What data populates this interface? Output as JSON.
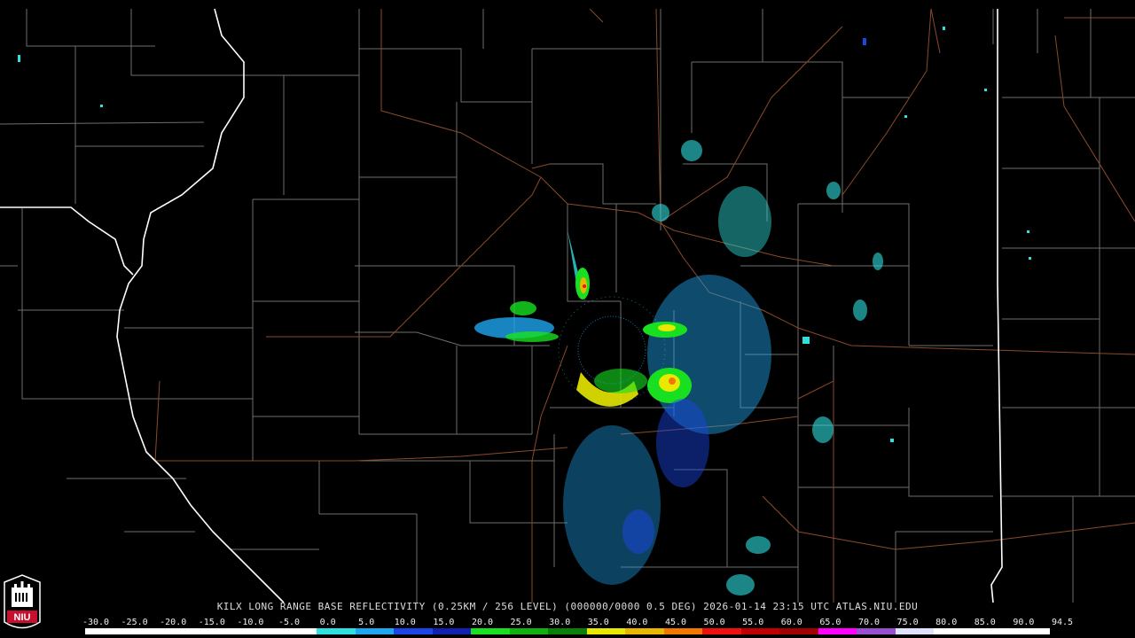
{
  "caption": "KILX LONG RANGE BASE REFLECTIVITY (0.25KM / 256 LEVEL) (000000/0000 0.5 DEG) 2026-01-14 23:15 UTC  ATLAS.NIU.EDU",
  "logo_text": "NIU",
  "colors": {
    "background": "#000000",
    "county_lines": "#8a8a8a",
    "state_lines": "#ffffff",
    "highways": "#8b4a2b"
  },
  "scale": {
    "labels": [
      "-30.0",
      "-25.0",
      "-20.0",
      "-15.0",
      "-10.0",
      "-5.0",
      "0.0",
      "5.0",
      "10.0",
      "15.0",
      "20.0",
      "25.0",
      "30.0",
      "35.0",
      "40.0",
      "45.0",
      "50.0",
      "55.0",
      "60.0",
      "65.0",
      "70.0",
      "75.0",
      "80.0",
      "85.0",
      "90.0",
      "94.5"
    ],
    "colors": [
      "#ffffff",
      "#ffffff",
      "#ffffff",
      "#ffffff",
      "#ffffff",
      "#ffffff",
      "#2fe0e0",
      "#1fa6f0",
      "#1a46e8",
      "#1020b0",
      "#18e020",
      "#10b010",
      "#0a8008",
      "#e8e800",
      "#e8b800",
      "#f07800",
      "#f01010",
      "#c00000",
      "#a00000",
      "#ff00ff",
      "#9850d0",
      "#e0e0ff",
      "#ffffff",
      "#ffffff",
      "#ffffff"
    ]
  }
}
